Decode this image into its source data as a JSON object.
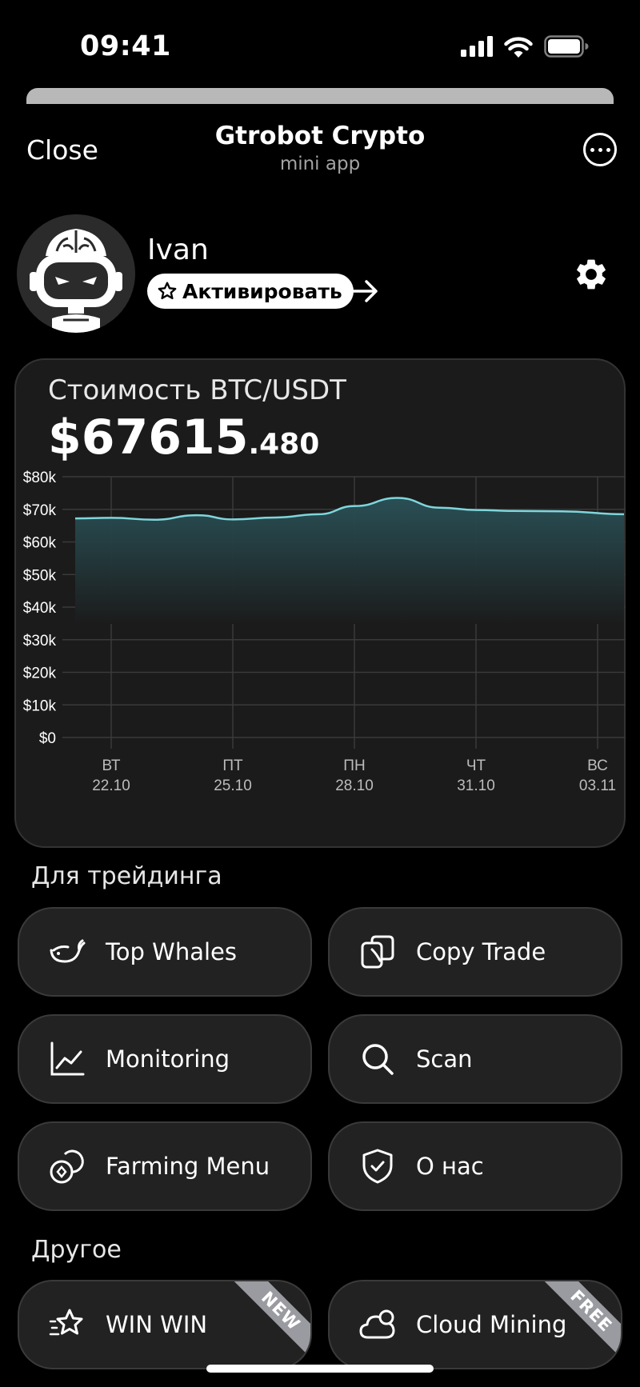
{
  "status_bar": {
    "time": "09:41"
  },
  "header": {
    "close_label": "Close",
    "title": "Gtrobot Crypto",
    "subtitle": "mini app"
  },
  "profile": {
    "name": "Ivan",
    "activate_label": "Активировать"
  },
  "price_card": {
    "caption": "Стоимость BTC/USDT",
    "price_main": "$67615",
    "price_decimals": ".480"
  },
  "chart_data": {
    "type": "area",
    "y_tick_labels": [
      "$80k",
      "$70k",
      "$60k",
      "$50k",
      "$40k",
      "$30k",
      "$20k",
      "$10k",
      "$0"
    ],
    "ylim": [
      0,
      80000
    ],
    "x_tick_labels": [
      {
        "day": "ВТ",
        "date": "22.10"
      },
      {
        "day": "ПТ",
        "date": "25.10"
      },
      {
        "day": "ПН",
        "date": "28.10"
      },
      {
        "day": "ЧТ",
        "date": "31.10"
      },
      {
        "day": "ВС",
        "date": "03.11"
      }
    ],
    "x": [
      0,
      0.3,
      0.65,
      1,
      1.3,
      1.65,
      2,
      2.3,
      2.65,
      3,
      3.3,
      3.6,
      4,
      4.3
    ],
    "values": [
      67200,
      67400,
      66800,
      68200,
      66900,
      67500,
      68500,
      71000,
      73500,
      70500,
      69800,
      69500,
      69400,
      68500
    ],
    "grid": true,
    "colors": {
      "line": "#7fd6dc",
      "fill_top": "#2a5258",
      "fill_bottom": "#1b1b1b",
      "grid": "#3a3a3a"
    }
  },
  "trading": {
    "title": "Для трейдинга",
    "items": [
      {
        "label": "Top Whales",
        "icon": "whale-icon"
      },
      {
        "label": "Copy Trade",
        "icon": "copy-trade-icon"
      },
      {
        "label": "Monitoring",
        "icon": "line-chart-icon"
      },
      {
        "label": "Scan",
        "icon": "search-icon"
      },
      {
        "label": "Farming Menu",
        "icon": "coins-icon"
      },
      {
        "label": "О нас",
        "icon": "shield-check-icon"
      }
    ]
  },
  "other": {
    "title": "Другое",
    "items": [
      {
        "label": "WIN WIN",
        "icon": "star-icon",
        "badge": "NEW"
      },
      {
        "label": "Cloud Mining",
        "icon": "cloud-icon",
        "badge": "FREE"
      }
    ]
  }
}
